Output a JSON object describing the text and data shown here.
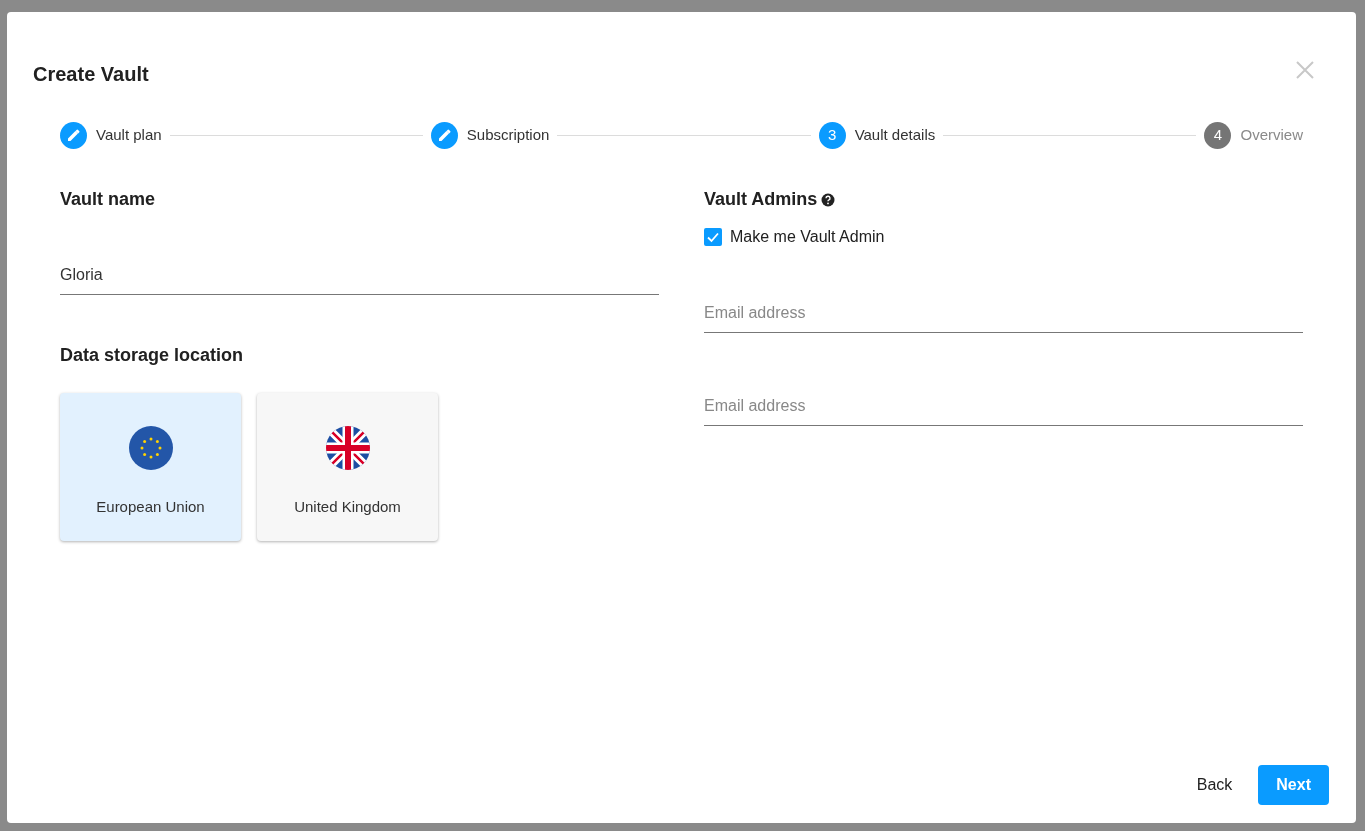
{
  "dialog": {
    "title": "Create Vault"
  },
  "steps": [
    {
      "label": "Vault plan",
      "kind": "done"
    },
    {
      "label": "Subscription",
      "kind": "done"
    },
    {
      "number": "3",
      "label": "Vault details",
      "kind": "active"
    },
    {
      "number": "4",
      "label": "Overview",
      "kind": "pending"
    }
  ],
  "vault_name": {
    "heading": "Vault name",
    "value": "Gloria"
  },
  "storage": {
    "heading": "Data storage location",
    "options": [
      {
        "label": "European Union",
        "kind": "eu",
        "selected": true
      },
      {
        "label": "United Kingdom",
        "kind": "uk",
        "selected": false
      }
    ]
  },
  "admins": {
    "heading": "Vault Admins",
    "make_me_admin": {
      "label": "Make me Vault Admin",
      "checked": true
    },
    "emails": [
      {
        "placeholder": "Email address"
      },
      {
        "placeholder": "Email address"
      }
    ]
  },
  "buttons": {
    "back": "Back",
    "next": "Next"
  }
}
